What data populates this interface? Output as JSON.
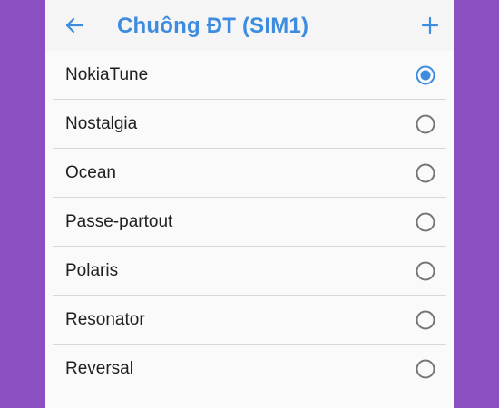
{
  "app_bar": {
    "title": "Chuông ĐT (SIM1)",
    "back_icon": "arrow-left-icon",
    "add_icon": "plus-icon",
    "accent_color": "#3d8ce0"
  },
  "ringtones": {
    "selected_index": 0,
    "items": [
      {
        "label": "NokiaTune",
        "selected": true
      },
      {
        "label": "Nostalgia",
        "selected": false
      },
      {
        "label": "Ocean",
        "selected": false
      },
      {
        "label": "Passe-partout",
        "selected": false
      },
      {
        "label": "Polaris",
        "selected": false
      },
      {
        "label": "Resonator",
        "selected": false
      },
      {
        "label": "Reversal",
        "selected": false
      }
    ]
  },
  "colors": {
    "background": "#8a4fc1",
    "radio_selected": "#3d8ce0",
    "radio_unselected": "#757575"
  }
}
